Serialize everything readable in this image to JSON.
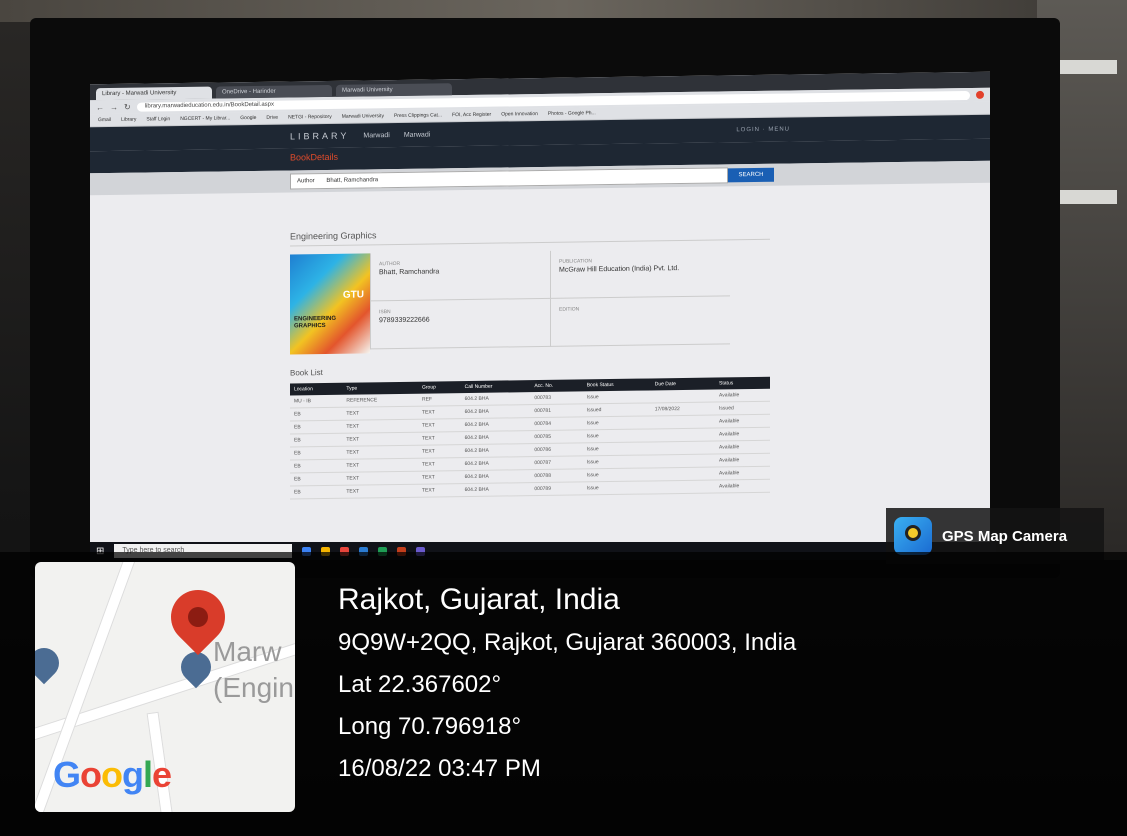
{
  "browser": {
    "tabs": [
      "Library - Marwadi University",
      "OneDrive - Harinder",
      "Marwadi University"
    ],
    "url": "library.marwadieducation.edu.in/BookDetail.aspx",
    "bookmarks": [
      "Gmail",
      "Library",
      "Staff Login",
      "NGCERT - My Librar...",
      "Google",
      "Drive",
      "NETGI - Repository",
      "Marwadi University",
      "Press Clippings Cat...",
      "FOI, Acc Register",
      "Open Innovation",
      "Photos - Google Ph..."
    ]
  },
  "site": {
    "brand": "LIBRARY",
    "logo1": "Marwadi",
    "logo2": "Marwadi",
    "login": "LOGIN · MENU",
    "page_heading": "BookDetails",
    "search_type": "Author",
    "search_query": "Bhatt, Ramchandra",
    "search_button": "SEARCH"
  },
  "book": {
    "title": "Engineering Graphics",
    "cover_label": "GTU",
    "cover_title": "ENGINEERING GRAPHICS",
    "author_label": "AUTHOR",
    "author": "Bhatt, Ramchandra",
    "publication_label": "PUBLICATION",
    "publication": "McGraw Hill Education (India) Pvt. Ltd.",
    "isbn_label": "ISBN",
    "isbn": "9789339222666",
    "edition_label": "EDITION"
  },
  "booklist": {
    "heading": "Book List",
    "columns": [
      "Location",
      "Type",
      "Group",
      "Call Number",
      "Acc. No.",
      "Book Status",
      "Due Date",
      "Status"
    ],
    "rows": [
      [
        "MU - IB",
        "REFERENCE",
        "REF",
        "604.2 BHA",
        "000783",
        "Issue",
        "",
        "Available"
      ],
      [
        "EB",
        "TEXT",
        "TEXT",
        "604.2 BHA",
        "000781",
        "Issued",
        "17/08/2022",
        "Issued"
      ],
      [
        "EB",
        "TEXT",
        "TEXT",
        "604.2 BHA",
        "000784",
        "Issue",
        "",
        "Available"
      ],
      [
        "EB",
        "TEXT",
        "TEXT",
        "604.2 BHA",
        "000785",
        "Issue",
        "",
        "Available"
      ],
      [
        "EB",
        "TEXT",
        "TEXT",
        "604.2 BHA",
        "000786",
        "Issue",
        "",
        "Available"
      ],
      [
        "EB",
        "TEXT",
        "TEXT",
        "604.2 BHA",
        "000787",
        "Issue",
        "",
        "Available"
      ],
      [
        "EB",
        "TEXT",
        "TEXT",
        "604.2 BHA",
        "000788",
        "Issue",
        "",
        "Available"
      ],
      [
        "EB",
        "TEXT",
        "TEXT",
        "604.2 BHA",
        "000789",
        "Issue",
        "",
        "Available"
      ]
    ]
  },
  "taskbar": {
    "search_placeholder": "Type here to search"
  },
  "gps_badge": "GPS Map Camera",
  "map": {
    "place_label": "Marw\n(Engin",
    "google": [
      "G",
      "o",
      "o",
      "g",
      "l",
      "e"
    ]
  },
  "location": {
    "city": "Rajkot, Gujarat, India",
    "address": "9Q9W+2QQ, Rajkot, Gujarat 360003, India",
    "lat": "Lat 22.367602°",
    "long": "Long 70.796918°",
    "datetime": "16/08/22 03:47 PM"
  },
  "colors": {
    "accent_orange": "#e04b2b",
    "search_blue": "#1a5fb4",
    "pin_red": "#d93c2a"
  }
}
